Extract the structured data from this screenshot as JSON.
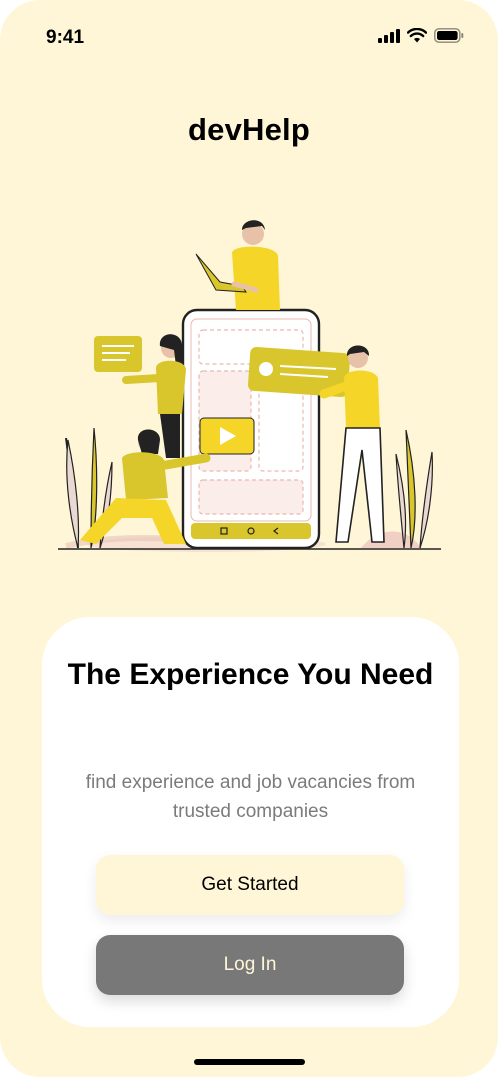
{
  "status_bar": {
    "time": "9:41",
    "icons": [
      "cellular-signal-icon",
      "wifi-icon",
      "battery-icon"
    ]
  },
  "app": {
    "title": "devHelp"
  },
  "illustration": {
    "description_icon": "team-with-phone-illustration"
  },
  "card": {
    "headline": "The Experience You Need",
    "subtitle": "find experience and job vacancies from trusted companies",
    "get_started_label": "Get Started",
    "login_label": "Log In"
  },
  "colors": {
    "background": "#FFF6D8",
    "accent_yellow": "#F5D628",
    "card": "#FFFFFF",
    "login_button": "#787878"
  }
}
